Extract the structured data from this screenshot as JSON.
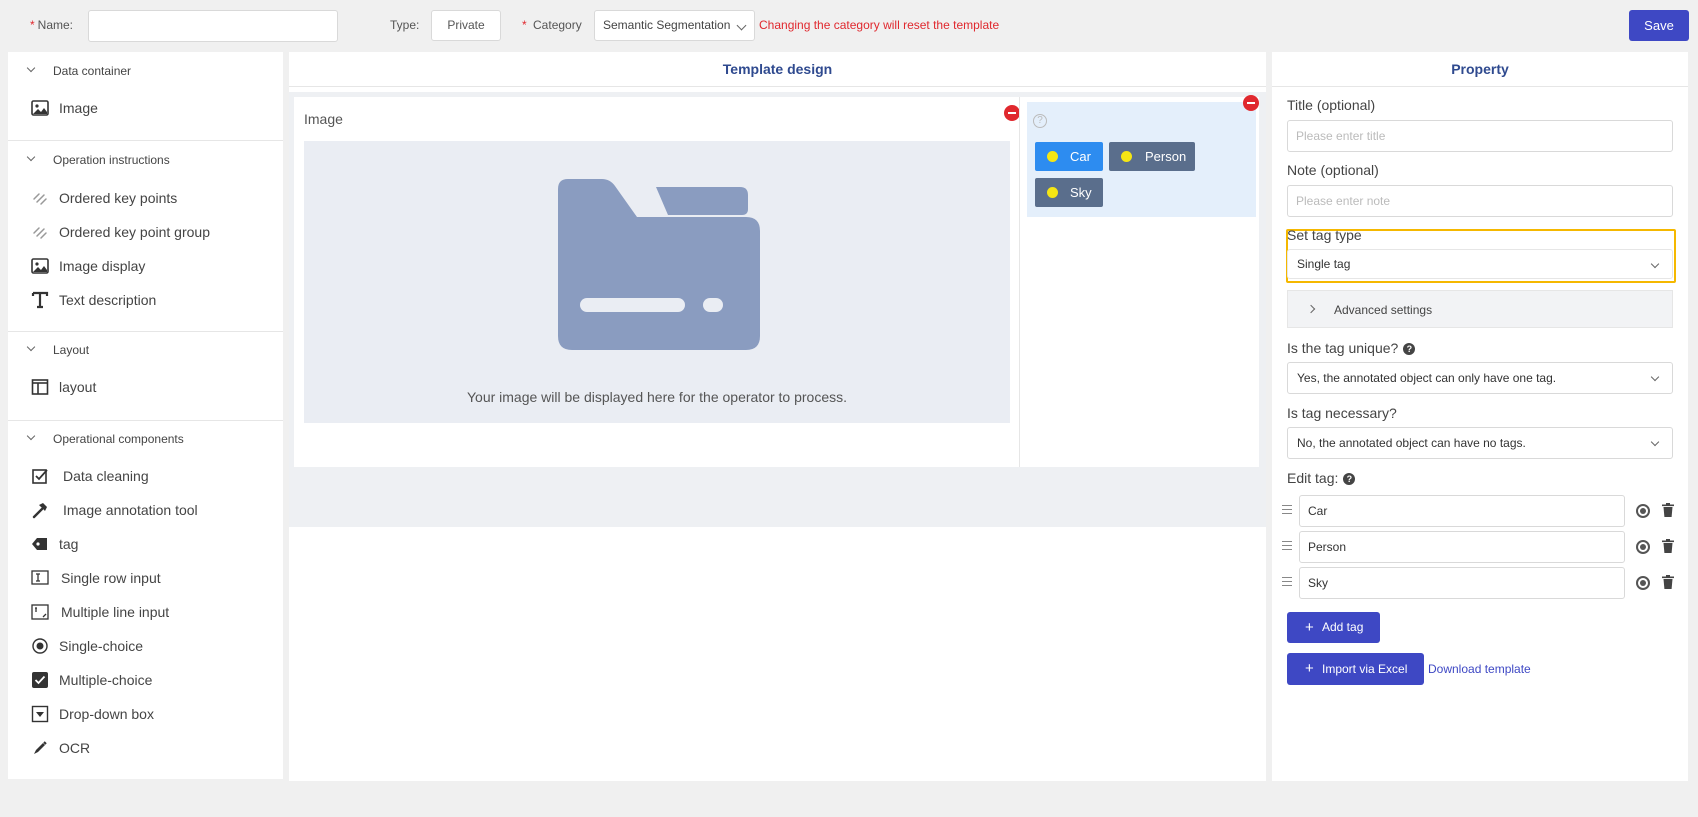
{
  "topbar": {
    "name_required": "*",
    "name_label": "Name:",
    "name_value": "",
    "type_label": "Type:",
    "type_value": "Private",
    "category_required": "*",
    "category_label": "Category",
    "category_value": "Semantic Segmentation",
    "category_warning": "Changing the category will reset the template",
    "save_label": "Save"
  },
  "left_panel": {
    "sections": [
      {
        "title": "Data container",
        "items": [
          {
            "label": "Image",
            "icon": "image-icon"
          }
        ]
      },
      {
        "title": "Operation instructions",
        "items": [
          {
            "label": "Ordered key points",
            "icon": "link-icon"
          },
          {
            "label": "Ordered key point group",
            "icon": "link-icon"
          },
          {
            "label": "Image display",
            "icon": "image-icon"
          },
          {
            "label": "Text description",
            "icon": "text-icon"
          }
        ]
      },
      {
        "title": "Layout",
        "items": [
          {
            "label": "layout",
            "icon": "layout-icon"
          }
        ]
      },
      {
        "title": "Operational components",
        "items": [
          {
            "label": "Data cleaning",
            "icon": "checkbox-icon"
          },
          {
            "label": "Image annotation tool",
            "icon": "hammer-icon"
          },
          {
            "label": "tag",
            "icon": "tag-icon"
          },
          {
            "label": "Single row input",
            "icon": "single-row-input-icon"
          },
          {
            "label": "Multiple line input",
            "icon": "multiline-input-icon"
          },
          {
            "label": "Single-choice",
            "icon": "radio-icon"
          },
          {
            "label": "Multiple-choice",
            "icon": "checked-box-icon"
          },
          {
            "label": "Drop-down box",
            "icon": "dropdown-icon"
          },
          {
            "label": "OCR",
            "icon": "pen-icon"
          }
        ]
      }
    ]
  },
  "center": {
    "title": "Template design",
    "image_card_title": "Image",
    "image_placeholder_text": "Your image will be displayed here for the operator to process.",
    "tag_chips": [
      {
        "label": "Car",
        "color": "#2d8cf0"
      },
      {
        "label": "Person",
        "color": "#5a6e8c"
      },
      {
        "label": "Sky",
        "color": "#5a6e8c"
      }
    ],
    "help_glyph": "?"
  },
  "property": {
    "title": "Property",
    "title_label": "Title (optional)",
    "title_placeholder": "Please enter title",
    "note_label": "Note (optional)",
    "note_placeholder": "Please enter note",
    "tag_type_label": "Set tag type",
    "tag_type_value": "Single tag",
    "advanced_label": "Advanced settings",
    "unique_label": "Is the tag unique?",
    "unique_value": "Yes, the annotated object can only have one tag.",
    "necessary_label": "Is tag necessary?",
    "necessary_value": "No, the annotated object can have no tags.",
    "edit_tag_label": "Edit tag:",
    "help_glyph": "?",
    "tags": [
      "Car",
      "Person",
      "Sky"
    ],
    "add_tag_label": "Add tag",
    "import_label": "Import via Excel",
    "download_label": "Download template",
    "plus_glyph": "+"
  },
  "colors": {
    "primary": "#3e48c4",
    "danger": "#e0282e",
    "highlight": "#f5b800",
    "tag_selected": "#2d8cf0",
    "tag_default": "#5a6e8c"
  }
}
